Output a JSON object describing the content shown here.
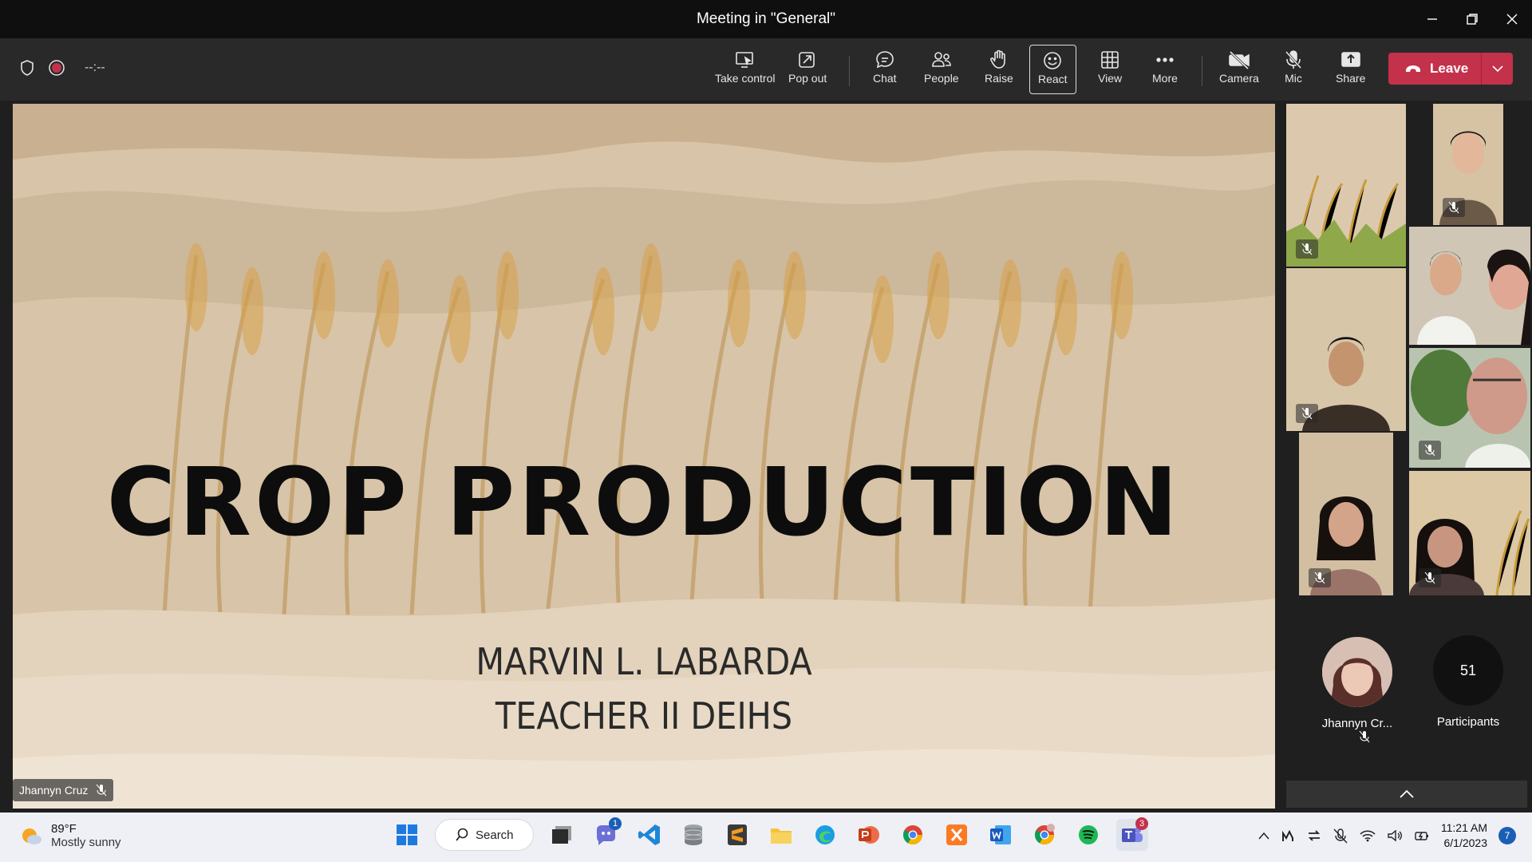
{
  "window": {
    "title": "Meeting in \"General\""
  },
  "toolbar": {
    "timer": "--:--",
    "buttons": {
      "take_control": "Take control",
      "pop_out": "Pop out",
      "chat": "Chat",
      "people": "People",
      "raise": "Raise",
      "react": "React",
      "view": "View",
      "more": "More",
      "camera": "Camera",
      "mic": "Mic",
      "share": "Share"
    },
    "leave_label": "Leave"
  },
  "slide": {
    "title": "CROP PRODUCTION",
    "presenter": "MARVIN L. LABARDA",
    "role": "TEACHER II DEIHS"
  },
  "presenter_tag": "Jhannyn Cruz",
  "side_panel": {
    "self_name": "Jhannyn Cr...",
    "participant_count": "51",
    "participants_label": "Participants"
  },
  "taskbar": {
    "weather_temp": "89°F",
    "weather_desc": "Mostly sunny",
    "search_label": "Search",
    "chat_badge": "1",
    "teams_badge": "3",
    "time": "11:21 AM",
    "date": "6/1/2023",
    "notification_count": "7"
  },
  "colors": {
    "leave": "#c4314b",
    "titlebar": "#0f0f0f",
    "toolbar": "#292929"
  }
}
